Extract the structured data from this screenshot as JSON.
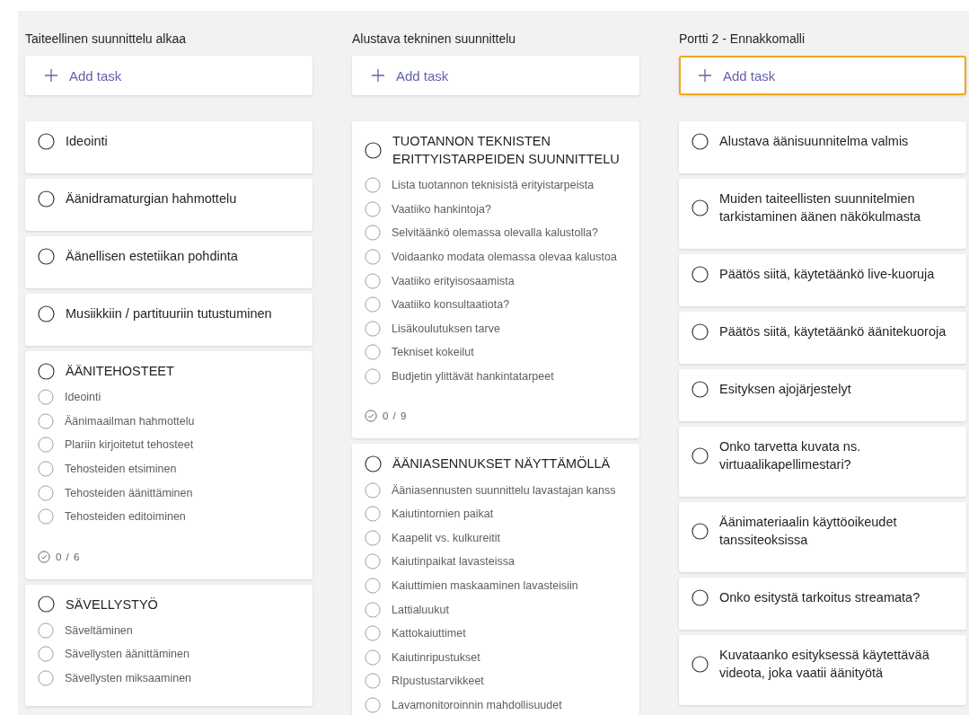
{
  "columns": [
    {
      "title": "Taiteellinen suunnittelu alkaa",
      "add_task": {
        "label": "Add task",
        "focused": false
      },
      "cards": [
        {
          "title": "Ideointi",
          "checked": false
        },
        {
          "title": "Äänidramaturgian hahmottelu",
          "checked": false
        },
        {
          "title": "Äänellisen estetiikan pohdinta",
          "checked": false
        },
        {
          "title": "Musiikkiin / partituuriin tutustuminen",
          "checked": false
        },
        {
          "title": "ÄÄNITEHOSTEET",
          "checked": false,
          "checklist": [
            {
              "label": "Ideointi",
              "checked": false
            },
            {
              "label": "Äänimaailman hahmottelu",
              "checked": false
            },
            {
              "label": "Plariin kirjoitetut tehosteet",
              "checked": false
            },
            {
              "label": "Tehosteiden etsiminen",
              "checked": false
            },
            {
              "label": "Tehosteiden äänittäminen",
              "checked": false
            },
            {
              "label": "Tehosteiden editoiminen",
              "checked": false
            }
          ],
          "progress": "0 / 6"
        },
        {
          "title": "SÄVELLYSTYÖ",
          "checked": false,
          "checklist": [
            {
              "label": "Säveltäminen",
              "checked": false
            },
            {
              "label": "Sävellysten äänittäminen",
              "checked": false
            },
            {
              "label": "Sävellysten miksaaminen",
              "checked": false
            }
          ]
        }
      ]
    },
    {
      "title": "Alustava tekninen suunnittelu",
      "add_task": {
        "label": "Add task",
        "focused": false
      },
      "cards": [
        {
          "title": "TUOTANNON TEKNISTEN ERITTYISTARPEIDEN SUUNNITTELU",
          "checked": false,
          "checklist": [
            {
              "label": "Lista tuotannon teknisistä erityistarpeista",
              "checked": false
            },
            {
              "label": "Vaatiiko hankintoja?",
              "checked": false
            },
            {
              "label": "Selvitäänkö olemassa olevalla kalustolla?",
              "checked": false
            },
            {
              "label": "Voidaanko modata olemassa olevaa kalustoa",
              "checked": false
            },
            {
              "label": "Vaatiiko erityisosaamista",
              "checked": false
            },
            {
              "label": "Vaatiiko konsultaatiota?",
              "checked": false
            },
            {
              "label": "Lisäkoulutuksen tarve",
              "checked": false
            },
            {
              "label": "Tekniset kokeilut",
              "checked": false
            },
            {
              "label": "Budjetin ylittävät hankintatarpeet",
              "checked": false
            }
          ],
          "progress": "0 / 9"
        },
        {
          "title": "ÄÄNIASENNUKSET NÄYTTÄMÖLLÄ",
          "checked": false,
          "checklist": [
            {
              "label": "Ääniasennusten suunnittelu lavastajan kanss",
              "checked": false
            },
            {
              "label": "Kaiutintornien paikat",
              "checked": false
            },
            {
              "label": "Kaapelit vs. kulkureitit",
              "checked": false
            },
            {
              "label": "Kaiutinpaikat lavasteissa",
              "checked": false
            },
            {
              "label": "Kaiuttimien maskaaminen lavasteisiin",
              "checked": false
            },
            {
              "label": "Lattialuukut",
              "checked": false
            },
            {
              "label": "Kattokaiuttimet",
              "checked": false
            },
            {
              "label": "Kaiutinripustukset",
              "checked": false
            },
            {
              "label": "RIpustustarvikkeet",
              "checked": false
            },
            {
              "label": "Lavamonitoroinnin mahdollisuudet",
              "checked": false
            }
          ]
        }
      ]
    },
    {
      "title": "Portti 2 - Ennakkomalli",
      "add_task": {
        "label": "Add task",
        "focused": true
      },
      "cards": [
        {
          "title": "Alustava äänisuunnitelma valmis",
          "checked": false
        },
        {
          "title": "Muiden taiteellisten suunnitelmien tarkistaminen äänen näkökulmasta",
          "checked": false
        },
        {
          "title": "Päätös siitä, käytetäänkö live-kuoruja",
          "checked": false
        },
        {
          "title": "Päätös siitä, käytetäänkö äänitekuoroja",
          "checked": false
        },
        {
          "title": "Esityksen ajojärjestelyt",
          "checked": false
        },
        {
          "title": "Onko tarvetta kuvata ns. virtuaalikapellimestari?",
          "checked": false
        },
        {
          "title": "Äänimateriaalin käyttöoikeudet tanssiteoksissa",
          "checked": false
        },
        {
          "title": "Onko esitystä tarkoitus streamata?",
          "checked": false
        },
        {
          "title": "Kuvataanko esityksessä käytettävää videota, joka vaatii äänityötä",
          "checked": false
        }
      ]
    }
  ]
}
